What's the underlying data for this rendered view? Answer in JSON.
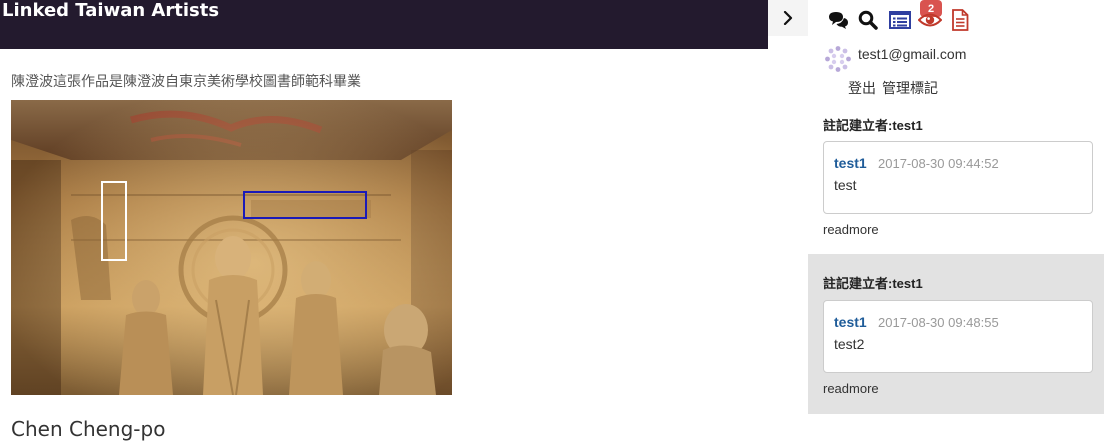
{
  "header": {
    "site_title": "Linked Taiwan Artists",
    "toggle_icon": "chevron-right-icon"
  },
  "main": {
    "caption": "陳澄波這張作品是陳澄波自東京美術學校圖書師範科畢業",
    "artist_name": "Chen Cheng-po"
  },
  "sidebar": {
    "toolbar": [
      {
        "icon": "comments-icon",
        "color": "#111111"
      },
      {
        "icon": "search-icon",
        "color": "#111111"
      },
      {
        "icon": "list-icon",
        "color": "#2f3fa0"
      },
      {
        "icon": "eye-icon",
        "color": "#c0392b"
      },
      {
        "icon": "document-icon",
        "color": "#c0392b"
      }
    ],
    "badge_count": "2",
    "user": {
      "email": "test1@gmail.com",
      "logout_label": "登出",
      "manage_label": "管理標記"
    },
    "notes": [
      {
        "author_label": "註記建立者:test1",
        "user": "test1",
        "time": "2017-08-30 09:44:52",
        "text": "test",
        "readmore": "readmore"
      },
      {
        "author_label": "註記建立者:test1",
        "user": "test1",
        "time": "2017-08-30 09:48:55",
        "text": "test2",
        "readmore": "readmore"
      }
    ]
  },
  "colors": {
    "topbar_bg": "#231a2e",
    "link_blue": "#1f5c99",
    "badge_red": "#d9534f",
    "annotation_blue": "#1a1ab8",
    "annotation_white": "#ffffff"
  }
}
